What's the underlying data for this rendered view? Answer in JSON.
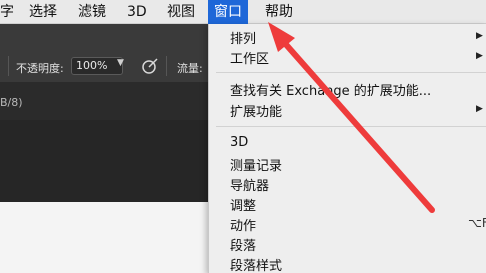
{
  "menubar": {
    "items": [
      {
        "label": "字"
      },
      {
        "label": "选择"
      },
      {
        "label": "滤镜"
      },
      {
        "label": "3D"
      },
      {
        "label": "视图"
      },
      {
        "label": "窗口"
      },
      {
        "label": "帮助"
      }
    ],
    "active_color": "#1e67d8"
  },
  "options_bar": {
    "opacity_label": "不透明度:",
    "opacity_value": "100%",
    "flow_label": "流量:"
  },
  "document": {
    "tab_partial": "B/8)"
  },
  "window_menu": {
    "items": [
      {
        "label": "排列",
        "has_submenu": true
      },
      {
        "label": "工作区",
        "has_submenu": true
      },
      {
        "label": "查找有关 Exchange 的扩展功能..."
      },
      {
        "label": "扩展功能",
        "has_submenu": true
      },
      {
        "label": "3D"
      },
      {
        "label": "测量记录"
      },
      {
        "label": "导航器"
      },
      {
        "label": "调整"
      },
      {
        "label": "动作",
        "shortcut": "⌥F"
      },
      {
        "label": "段落"
      },
      {
        "label": "段落样式"
      }
    ]
  },
  "annotation": {
    "arrow_color": "#ee3b3b"
  }
}
